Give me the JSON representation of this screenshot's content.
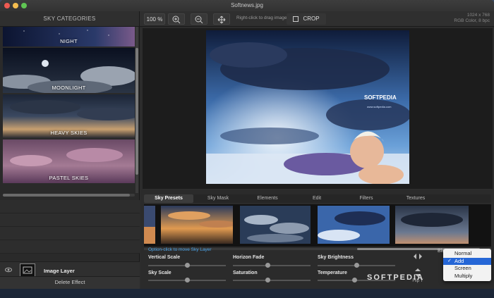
{
  "window": {
    "title": "Softnews.jpg"
  },
  "sidebar": {
    "heading": "SKY CATEGORIES",
    "categories": [
      {
        "label": "NIGHT"
      },
      {
        "label": "MOONLIGHT"
      },
      {
        "label": "HEAVY SKIES"
      },
      {
        "label": "PASTEL SKIES"
      }
    ],
    "layer": {
      "name": "Image Layer"
    },
    "delete_label": "Delete Effect"
  },
  "toolbar": {
    "zoom": "100 %",
    "drag_hint": "Right-click to drag image",
    "crop_label": "CROP",
    "image_size": "1024 x 768",
    "image_info": "RGB Color, 8 bpc"
  },
  "photo": {
    "brand": "SOFTPEDIA",
    "brand_url": "www.softpedia.com"
  },
  "bottom": {
    "tabs": [
      {
        "label": "Sky Presets",
        "active": true
      },
      {
        "label": "Sky Mask",
        "active": false
      },
      {
        "label": "Elements",
        "active": false
      },
      {
        "label": "Edit",
        "active": false
      },
      {
        "label": "Filters",
        "active": false
      },
      {
        "label": "Textures",
        "active": false
      }
    ],
    "move_hint": "Option-click to move Sky Layer",
    "controls": [
      {
        "label": "Vertical Scale",
        "value": 0.5
      },
      {
        "label": "Horizon Fade",
        "value": 0.45
      },
      {
        "label": "Sky Brightness",
        "value": 0.5
      },
      {
        "label": "Sky Scale",
        "value": 0.5
      },
      {
        "label": "Saturation",
        "value": 0.45
      },
      {
        "label": "Temperature",
        "value": 0.48
      }
    ],
    "flip_y_label": "Flip Y",
    "blend_label": "Ble",
    "blend_options": [
      {
        "label": "Normal",
        "selected": false
      },
      {
        "label": "Add",
        "selected": true
      },
      {
        "label": "Screen",
        "selected": false
      },
      {
        "label": "Multiply",
        "selected": false
      }
    ]
  },
  "watermark": "SOFTPEDIA",
  "colors": {
    "accent": "#2566d6",
    "hint": "#4aa3e8",
    "window_bg": "#2c2c2c"
  }
}
